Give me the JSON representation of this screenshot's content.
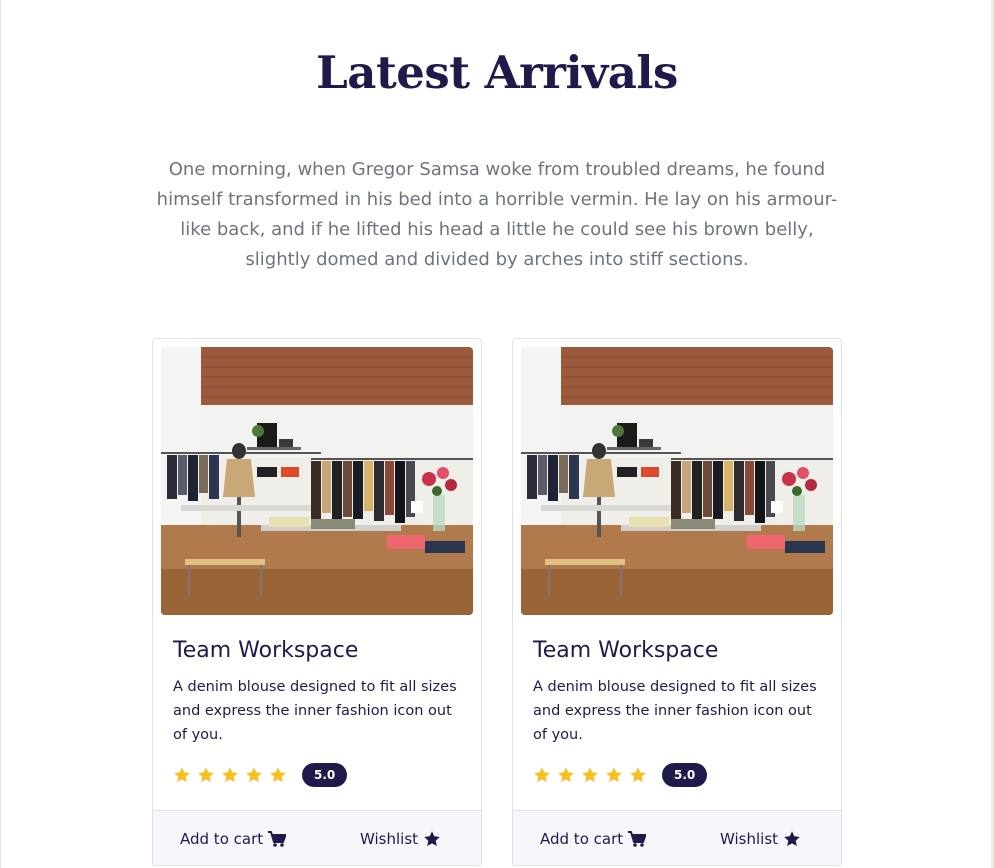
{
  "section": {
    "title": "Latest Arrivals",
    "lede": "One morning, when Gregor Samsa woke from troubled dreams, he found himself transformed in his bed into a horrible vermin. He lay on his armour-like back, and if he lifted his head a little he could see his brown belly, slightly domed and divided by arches into stiff sections."
  },
  "products": [
    {
      "title": "Team Workspace",
      "description": "A denim blouse designed to fit all sizes and express the inner fashion icon out of you.",
      "stars": 5,
      "rating": "5.0",
      "cart_label": "Add to cart",
      "cart_icon": "cart-icon",
      "wishlist_label": "Wishlist",
      "wishlist_icon": "star-icon",
      "image": "clothing-store-photo"
    },
    {
      "title": "Team Workspace",
      "description": "A denim blouse designed to fit all sizes and express the inner fashion icon out of you.",
      "stars": 5,
      "rating": "5.0",
      "cart_label": "Add to cart",
      "cart_icon": "cart-icon",
      "wishlist_label": "Wishlist",
      "wishlist_icon": "star-icon",
      "image": "clothing-store-photo"
    }
  ],
  "colors": {
    "heading": "#1e1b4b",
    "muted_text": "#6c757d",
    "star": "#fbbf24",
    "footer_bg": "#f5f7fa"
  }
}
